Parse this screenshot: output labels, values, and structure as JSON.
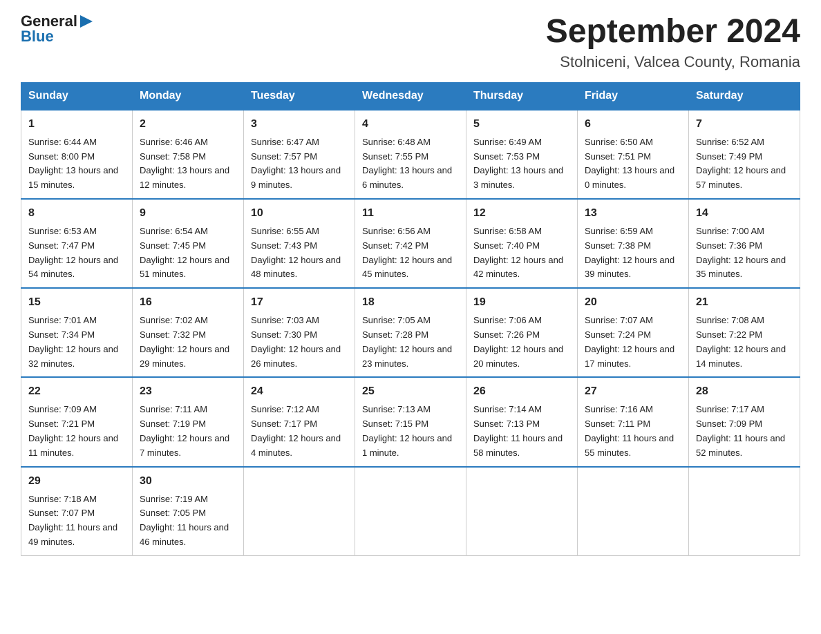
{
  "header": {
    "logo": {
      "text_general": "General",
      "text_blue": "Blue",
      "arrow": "▶"
    },
    "title": "September 2024",
    "subtitle": "Stolniceni, Valcea County, Romania"
  },
  "weekdays": [
    "Sunday",
    "Monday",
    "Tuesday",
    "Wednesday",
    "Thursday",
    "Friday",
    "Saturday"
  ],
  "weeks": [
    [
      {
        "day": "1",
        "sunrise": "6:44 AM",
        "sunset": "8:00 PM",
        "daylight": "13 hours and 15 minutes."
      },
      {
        "day": "2",
        "sunrise": "6:46 AM",
        "sunset": "7:58 PM",
        "daylight": "13 hours and 12 minutes."
      },
      {
        "day": "3",
        "sunrise": "6:47 AM",
        "sunset": "7:57 PM",
        "daylight": "13 hours and 9 minutes."
      },
      {
        "day": "4",
        "sunrise": "6:48 AM",
        "sunset": "7:55 PM",
        "daylight": "13 hours and 6 minutes."
      },
      {
        "day": "5",
        "sunrise": "6:49 AM",
        "sunset": "7:53 PM",
        "daylight": "13 hours and 3 minutes."
      },
      {
        "day": "6",
        "sunrise": "6:50 AM",
        "sunset": "7:51 PM",
        "daylight": "13 hours and 0 minutes."
      },
      {
        "day": "7",
        "sunrise": "6:52 AM",
        "sunset": "7:49 PM",
        "daylight": "12 hours and 57 minutes."
      }
    ],
    [
      {
        "day": "8",
        "sunrise": "6:53 AM",
        "sunset": "7:47 PM",
        "daylight": "12 hours and 54 minutes."
      },
      {
        "day": "9",
        "sunrise": "6:54 AM",
        "sunset": "7:45 PM",
        "daylight": "12 hours and 51 minutes."
      },
      {
        "day": "10",
        "sunrise": "6:55 AM",
        "sunset": "7:43 PM",
        "daylight": "12 hours and 48 minutes."
      },
      {
        "day": "11",
        "sunrise": "6:56 AM",
        "sunset": "7:42 PM",
        "daylight": "12 hours and 45 minutes."
      },
      {
        "day": "12",
        "sunrise": "6:58 AM",
        "sunset": "7:40 PM",
        "daylight": "12 hours and 42 minutes."
      },
      {
        "day": "13",
        "sunrise": "6:59 AM",
        "sunset": "7:38 PM",
        "daylight": "12 hours and 39 minutes."
      },
      {
        "day": "14",
        "sunrise": "7:00 AM",
        "sunset": "7:36 PM",
        "daylight": "12 hours and 35 minutes."
      }
    ],
    [
      {
        "day": "15",
        "sunrise": "7:01 AM",
        "sunset": "7:34 PM",
        "daylight": "12 hours and 32 minutes."
      },
      {
        "day": "16",
        "sunrise": "7:02 AM",
        "sunset": "7:32 PM",
        "daylight": "12 hours and 29 minutes."
      },
      {
        "day": "17",
        "sunrise": "7:03 AM",
        "sunset": "7:30 PM",
        "daylight": "12 hours and 26 minutes."
      },
      {
        "day": "18",
        "sunrise": "7:05 AM",
        "sunset": "7:28 PM",
        "daylight": "12 hours and 23 minutes."
      },
      {
        "day": "19",
        "sunrise": "7:06 AM",
        "sunset": "7:26 PM",
        "daylight": "12 hours and 20 minutes."
      },
      {
        "day": "20",
        "sunrise": "7:07 AM",
        "sunset": "7:24 PM",
        "daylight": "12 hours and 17 minutes."
      },
      {
        "day": "21",
        "sunrise": "7:08 AM",
        "sunset": "7:22 PM",
        "daylight": "12 hours and 14 minutes."
      }
    ],
    [
      {
        "day": "22",
        "sunrise": "7:09 AM",
        "sunset": "7:21 PM",
        "daylight": "12 hours and 11 minutes."
      },
      {
        "day": "23",
        "sunrise": "7:11 AM",
        "sunset": "7:19 PM",
        "daylight": "12 hours and 7 minutes."
      },
      {
        "day": "24",
        "sunrise": "7:12 AM",
        "sunset": "7:17 PM",
        "daylight": "12 hours and 4 minutes."
      },
      {
        "day": "25",
        "sunrise": "7:13 AM",
        "sunset": "7:15 PM",
        "daylight": "12 hours and 1 minute."
      },
      {
        "day": "26",
        "sunrise": "7:14 AM",
        "sunset": "7:13 PM",
        "daylight": "11 hours and 58 minutes."
      },
      {
        "day": "27",
        "sunrise": "7:16 AM",
        "sunset": "7:11 PM",
        "daylight": "11 hours and 55 minutes."
      },
      {
        "day": "28",
        "sunrise": "7:17 AM",
        "sunset": "7:09 PM",
        "daylight": "11 hours and 52 minutes."
      }
    ],
    [
      {
        "day": "29",
        "sunrise": "7:18 AM",
        "sunset": "7:07 PM",
        "daylight": "11 hours and 49 minutes."
      },
      {
        "day": "30",
        "sunrise": "7:19 AM",
        "sunset": "7:05 PM",
        "daylight": "11 hours and 46 minutes."
      },
      null,
      null,
      null,
      null,
      null
    ]
  ],
  "labels": {
    "sunrise": "Sunrise:",
    "sunset": "Sunset:",
    "daylight": "Daylight:"
  }
}
